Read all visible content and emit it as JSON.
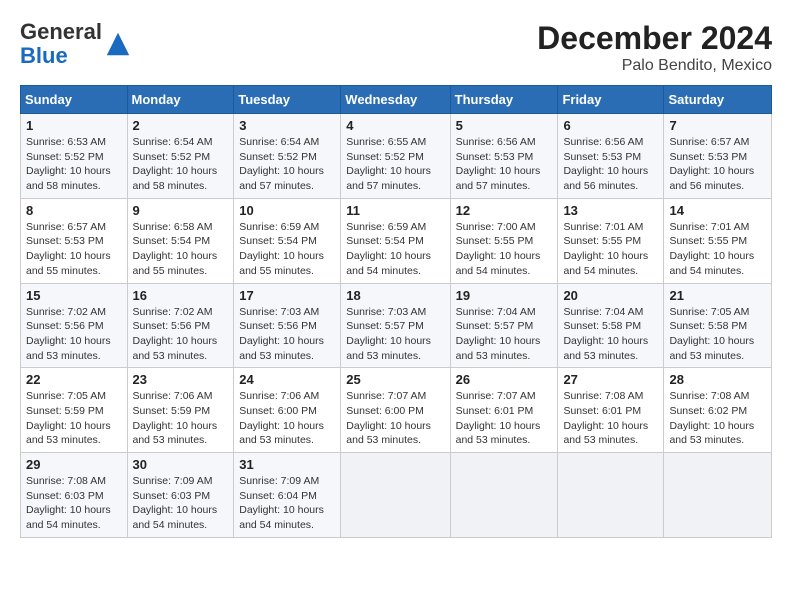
{
  "header": {
    "logo_general": "General",
    "logo_blue": "Blue",
    "title": "December 2024",
    "subtitle": "Palo Bendito, Mexico"
  },
  "weekdays": [
    "Sunday",
    "Monday",
    "Tuesday",
    "Wednesday",
    "Thursday",
    "Friday",
    "Saturday"
  ],
  "weeks": [
    [
      {
        "day": "1",
        "sunrise": "6:53 AM",
        "sunset": "5:52 PM",
        "daylight": "10 hours and 58 minutes."
      },
      {
        "day": "2",
        "sunrise": "6:54 AM",
        "sunset": "5:52 PM",
        "daylight": "10 hours and 58 minutes."
      },
      {
        "day": "3",
        "sunrise": "6:54 AM",
        "sunset": "5:52 PM",
        "daylight": "10 hours and 57 minutes."
      },
      {
        "day": "4",
        "sunrise": "6:55 AM",
        "sunset": "5:52 PM",
        "daylight": "10 hours and 57 minutes."
      },
      {
        "day": "5",
        "sunrise": "6:56 AM",
        "sunset": "5:53 PM",
        "daylight": "10 hours and 57 minutes."
      },
      {
        "day": "6",
        "sunrise": "6:56 AM",
        "sunset": "5:53 PM",
        "daylight": "10 hours and 56 minutes."
      },
      {
        "day": "7",
        "sunrise": "6:57 AM",
        "sunset": "5:53 PM",
        "daylight": "10 hours and 56 minutes."
      }
    ],
    [
      {
        "day": "8",
        "sunrise": "6:57 AM",
        "sunset": "5:53 PM",
        "daylight": "10 hours and 55 minutes."
      },
      {
        "day": "9",
        "sunrise": "6:58 AM",
        "sunset": "5:54 PM",
        "daylight": "10 hours and 55 minutes."
      },
      {
        "day": "10",
        "sunrise": "6:59 AM",
        "sunset": "5:54 PM",
        "daylight": "10 hours and 55 minutes."
      },
      {
        "day": "11",
        "sunrise": "6:59 AM",
        "sunset": "5:54 PM",
        "daylight": "10 hours and 54 minutes."
      },
      {
        "day": "12",
        "sunrise": "7:00 AM",
        "sunset": "5:55 PM",
        "daylight": "10 hours and 54 minutes."
      },
      {
        "day": "13",
        "sunrise": "7:01 AM",
        "sunset": "5:55 PM",
        "daylight": "10 hours and 54 minutes."
      },
      {
        "day": "14",
        "sunrise": "7:01 AM",
        "sunset": "5:55 PM",
        "daylight": "10 hours and 54 minutes."
      }
    ],
    [
      {
        "day": "15",
        "sunrise": "7:02 AM",
        "sunset": "5:56 PM",
        "daylight": "10 hours and 53 minutes."
      },
      {
        "day": "16",
        "sunrise": "7:02 AM",
        "sunset": "5:56 PM",
        "daylight": "10 hours and 53 minutes."
      },
      {
        "day": "17",
        "sunrise": "7:03 AM",
        "sunset": "5:56 PM",
        "daylight": "10 hours and 53 minutes."
      },
      {
        "day": "18",
        "sunrise": "7:03 AM",
        "sunset": "5:57 PM",
        "daylight": "10 hours and 53 minutes."
      },
      {
        "day": "19",
        "sunrise": "7:04 AM",
        "sunset": "5:57 PM",
        "daylight": "10 hours and 53 minutes."
      },
      {
        "day": "20",
        "sunrise": "7:04 AM",
        "sunset": "5:58 PM",
        "daylight": "10 hours and 53 minutes."
      },
      {
        "day": "21",
        "sunrise": "7:05 AM",
        "sunset": "5:58 PM",
        "daylight": "10 hours and 53 minutes."
      }
    ],
    [
      {
        "day": "22",
        "sunrise": "7:05 AM",
        "sunset": "5:59 PM",
        "daylight": "10 hours and 53 minutes."
      },
      {
        "day": "23",
        "sunrise": "7:06 AM",
        "sunset": "5:59 PM",
        "daylight": "10 hours and 53 minutes."
      },
      {
        "day": "24",
        "sunrise": "7:06 AM",
        "sunset": "6:00 PM",
        "daylight": "10 hours and 53 minutes."
      },
      {
        "day": "25",
        "sunrise": "7:07 AM",
        "sunset": "6:00 PM",
        "daylight": "10 hours and 53 minutes."
      },
      {
        "day": "26",
        "sunrise": "7:07 AM",
        "sunset": "6:01 PM",
        "daylight": "10 hours and 53 minutes."
      },
      {
        "day": "27",
        "sunrise": "7:08 AM",
        "sunset": "6:01 PM",
        "daylight": "10 hours and 53 minutes."
      },
      {
        "day": "28",
        "sunrise": "7:08 AM",
        "sunset": "6:02 PM",
        "daylight": "10 hours and 53 minutes."
      }
    ],
    [
      {
        "day": "29",
        "sunrise": "7:08 AM",
        "sunset": "6:03 PM",
        "daylight": "10 hours and 54 minutes."
      },
      {
        "day": "30",
        "sunrise": "7:09 AM",
        "sunset": "6:03 PM",
        "daylight": "10 hours and 54 minutes."
      },
      {
        "day": "31",
        "sunrise": "7:09 AM",
        "sunset": "6:04 PM",
        "daylight": "10 hours and 54 minutes."
      },
      null,
      null,
      null,
      null
    ]
  ]
}
